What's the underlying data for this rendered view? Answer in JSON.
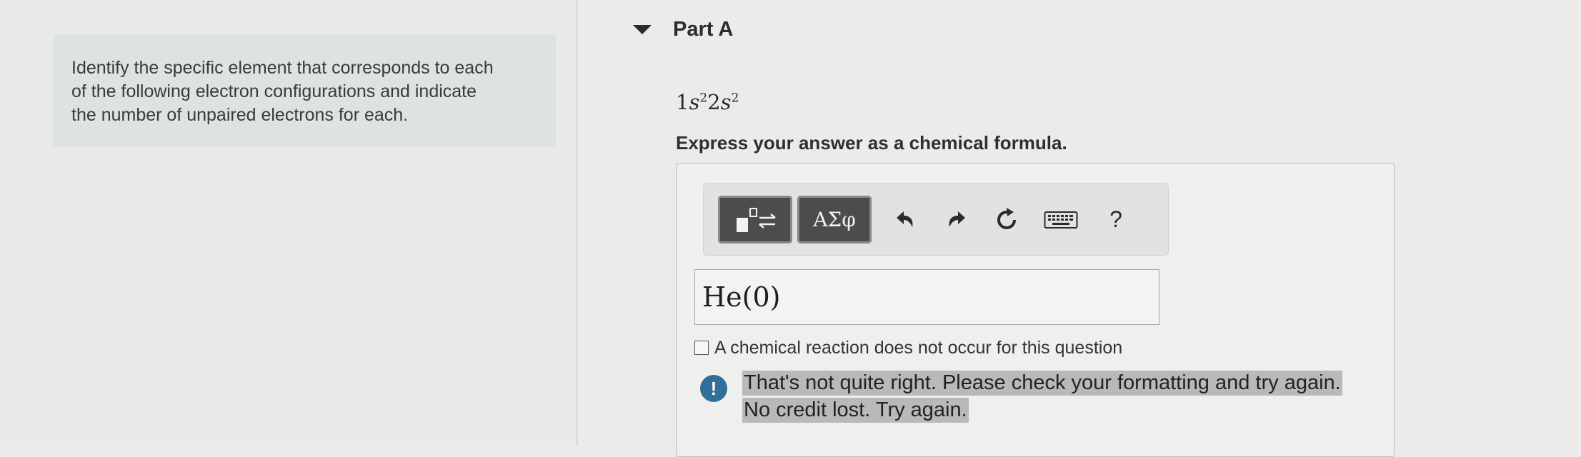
{
  "intro": {
    "lines": [
      "Identify the specific element that corresponds to each",
      "of the following electron configurations and indicate",
      "the number of unpaired electrons for each."
    ]
  },
  "part": {
    "title": "Part A"
  },
  "question": {
    "config": {
      "n1": "1",
      "l1": "s",
      "e1": "2",
      "n2": "2",
      "l2": "s",
      "e2": "2"
    },
    "instruction": "Express your answer as a chemical formula."
  },
  "toolbar": {
    "symbols_label": "ΑΣφ",
    "help_label": "?",
    "icons": [
      "templates-icon",
      "undo-icon",
      "redo-icon",
      "reset-icon",
      "keyboard-icon"
    ]
  },
  "answer": {
    "value": "He(0)"
  },
  "no_reaction": {
    "label": "A chemical reaction does not occur for this question",
    "checked": false
  },
  "feedback": {
    "line1": "That's not quite right. Please check your formatting and try again.",
    "line2": "No credit lost. Try again.",
    "icon_label": "!",
    "icon_color": "#2f6f9a"
  }
}
